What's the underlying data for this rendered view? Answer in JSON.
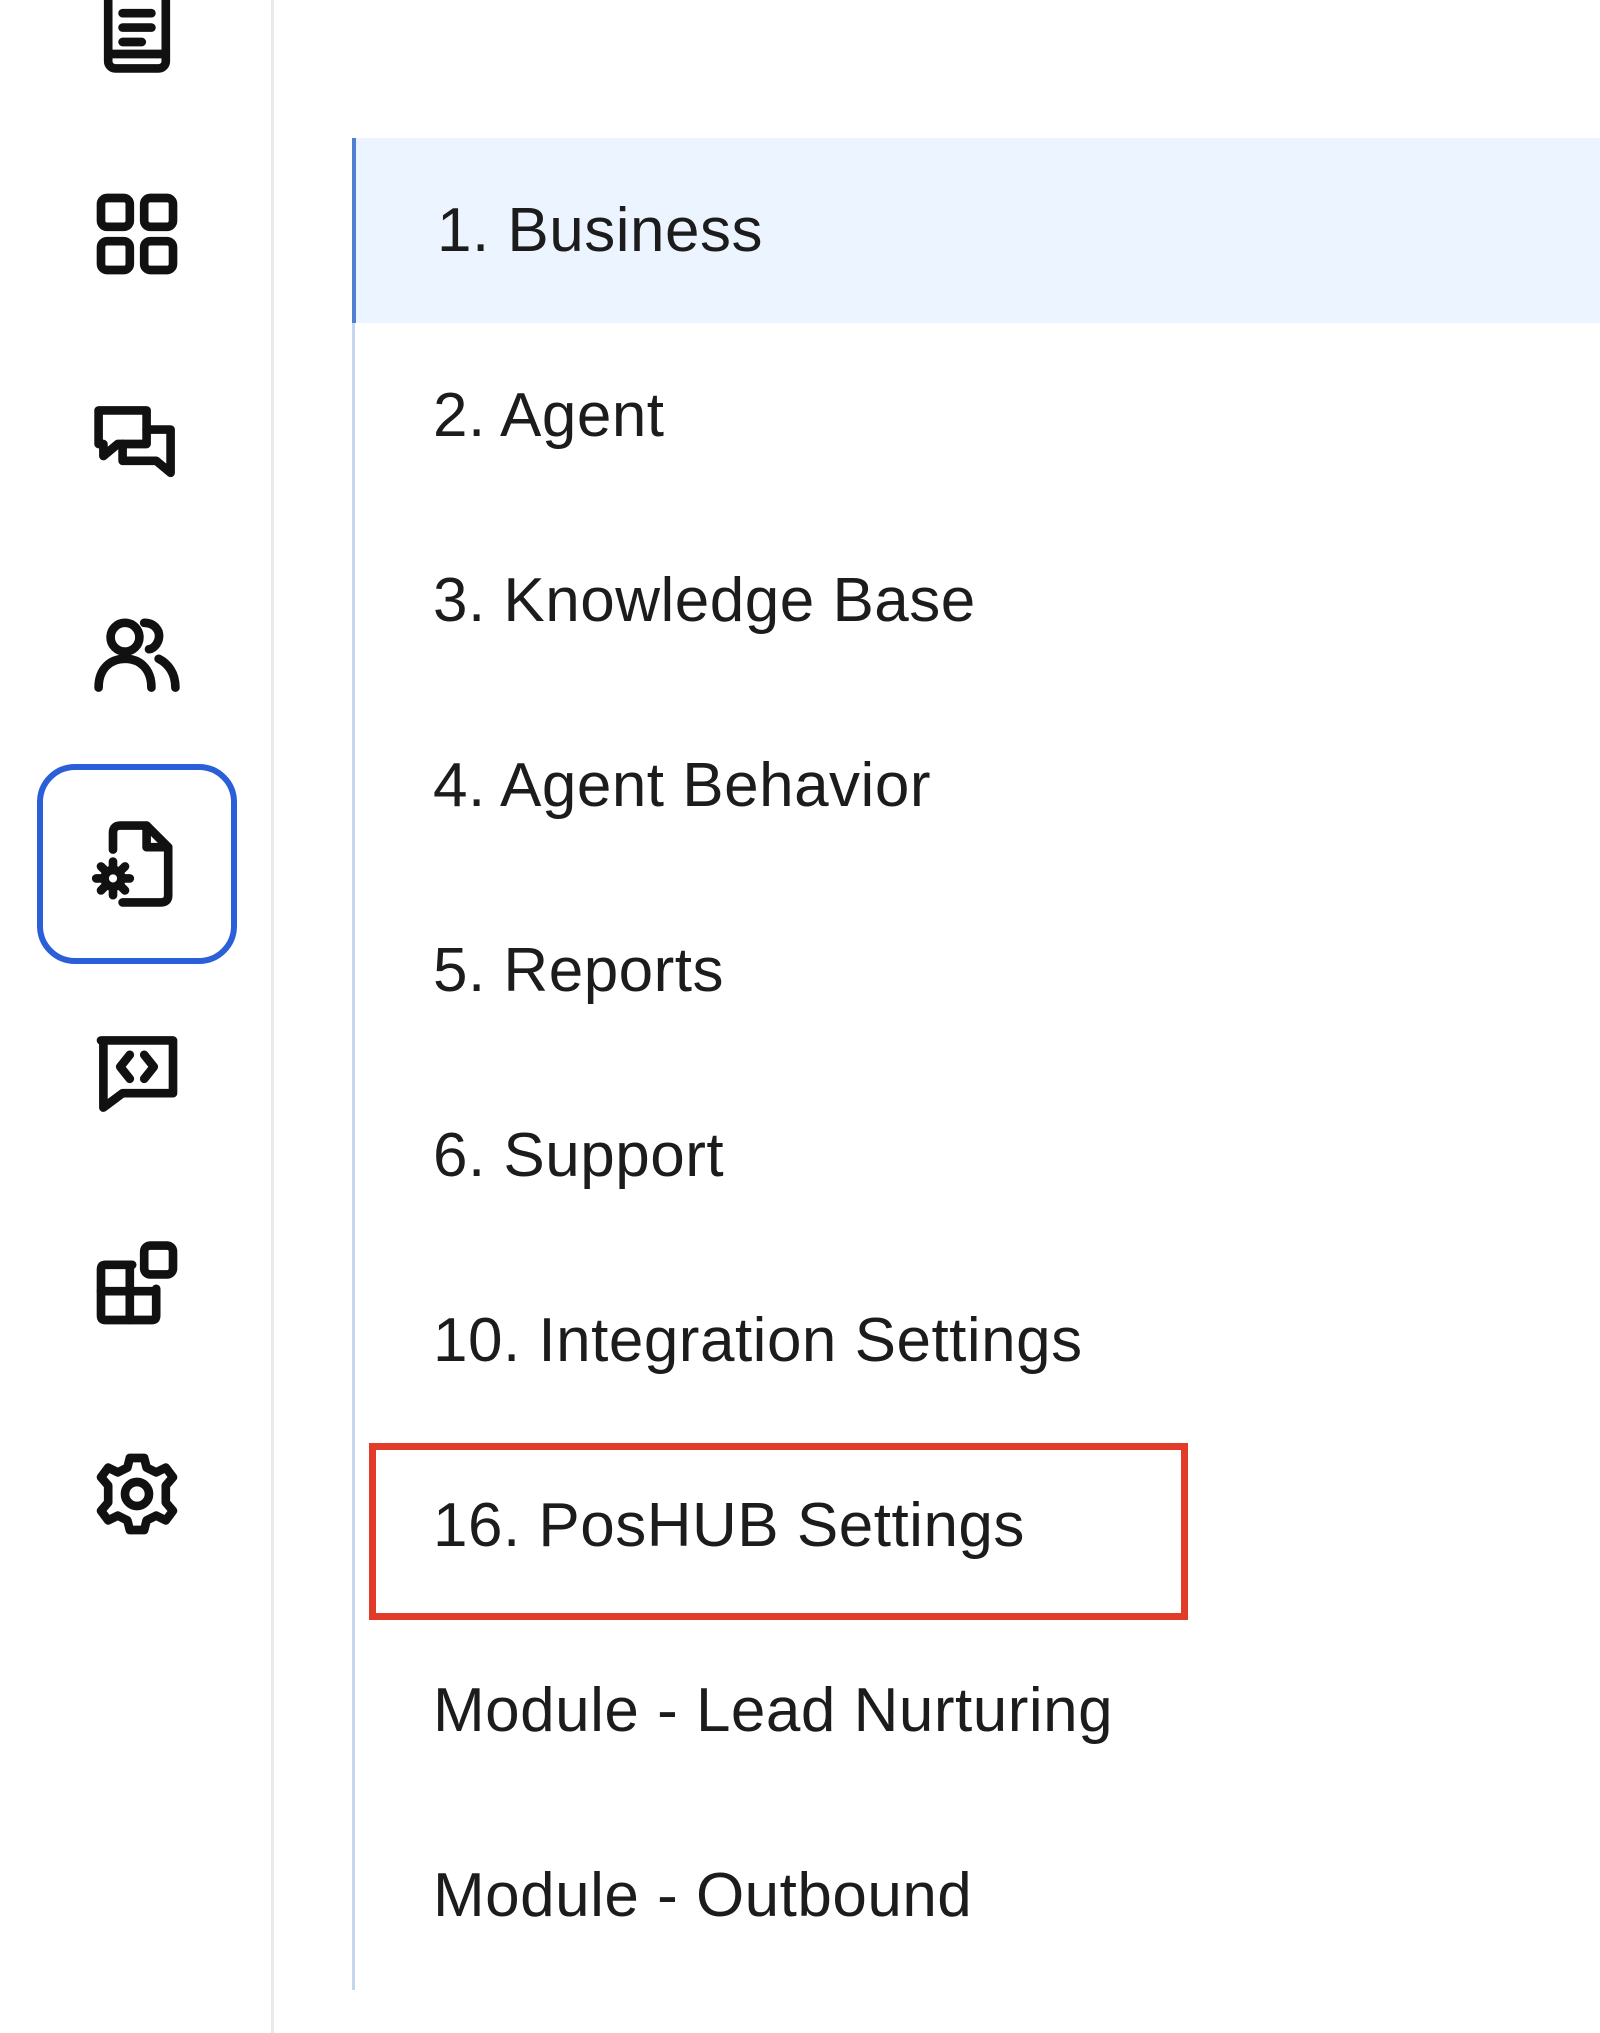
{
  "rail": {
    "items": [
      {
        "icon": "document-icon",
        "active": false
      },
      {
        "icon": "grid-icon",
        "active": false
      },
      {
        "icon": "chat-bubbles-icon",
        "active": false
      },
      {
        "icon": "users-icon",
        "active": false
      },
      {
        "icon": "file-settings-icon",
        "active": true
      },
      {
        "icon": "code-message-icon",
        "active": false
      },
      {
        "icon": "add-widget-icon",
        "active": false
      },
      {
        "icon": "gear-icon",
        "active": false
      }
    ],
    "active_color": "#2b5fd9"
  },
  "menu": {
    "items": [
      {
        "label": "1. Business",
        "selected": true
      },
      {
        "label": "2. Agent",
        "selected": false
      },
      {
        "label": "3. Knowledge Base",
        "selected": false
      },
      {
        "label": "4. Agent Behavior",
        "selected": false
      },
      {
        "label": "5. Reports",
        "selected": false
      },
      {
        "label": "6. Support",
        "selected": false
      },
      {
        "label": "10. Integration Settings",
        "selected": false
      },
      {
        "label": "16. PosHUB Settings",
        "selected": false,
        "highlighted": true
      },
      {
        "label": "Module - Lead Nurturing",
        "selected": false
      },
      {
        "label": "Module - Outbound",
        "selected": false
      }
    ],
    "selected_bg": "#ecf4ff",
    "highlight_color": "#e23b2a"
  }
}
